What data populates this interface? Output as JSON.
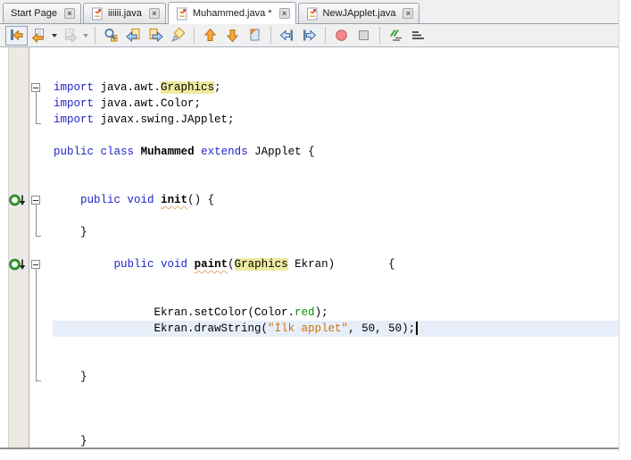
{
  "tab_bar": {
    "tabs": [
      {
        "id": "start-page",
        "label": "Start Page",
        "icon": null,
        "active": false,
        "closable": true
      },
      {
        "id": "iiiiii-java",
        "label": "iiiiii.java",
        "icon": "java-file",
        "active": false,
        "closable": true
      },
      {
        "id": "muhammed-java",
        "label": "Muhammed.java *",
        "icon": "java-file",
        "active": true,
        "closable": true,
        "modified": true
      },
      {
        "id": "newjapplet-java",
        "label": "NewJApplet.java",
        "icon": "java-file",
        "active": false,
        "closable": true
      }
    ]
  },
  "toolbar": {
    "items": [
      {
        "type": "button",
        "name": "last-edit-location",
        "framed": true
      },
      {
        "type": "button",
        "name": "back",
        "dropdown": true
      },
      {
        "type": "button",
        "name": "forward",
        "dropdown": true,
        "disabled": true
      },
      {
        "type": "separator"
      },
      {
        "type": "button",
        "name": "find-selection"
      },
      {
        "type": "button",
        "name": "find-previous-occurrence"
      },
      {
        "type": "button",
        "name": "find-next-occurrence"
      },
      {
        "type": "button",
        "name": "toggle-highlight-search"
      },
      {
        "type": "separator"
      },
      {
        "type": "button",
        "name": "previous-bookmark"
      },
      {
        "type": "button",
        "name": "next-bookmark"
      },
      {
        "type": "button",
        "name": "toggle-bookmark"
      },
      {
        "type": "separator"
      },
      {
        "type": "button",
        "name": "shift-line-left"
      },
      {
        "type": "button",
        "name": "shift-line-right"
      },
      {
        "type": "separator"
      },
      {
        "type": "button",
        "name": "start-macro-recording"
      },
      {
        "type": "button",
        "name": "stop-macro-recording"
      },
      {
        "type": "separator"
      },
      {
        "type": "button",
        "name": "comment"
      },
      {
        "type": "button",
        "name": "uncomment"
      }
    ]
  },
  "editor": {
    "language": "java",
    "current_line": 16,
    "caret": {
      "line": 16
    },
    "gutter_icons": [
      {
        "line": 8,
        "name": "overridden-method"
      },
      {
        "line": 12,
        "name": "overridden-method"
      }
    ],
    "folds": [
      {
        "start": 1,
        "end": 3
      },
      {
        "start": 8,
        "end": 10
      },
      {
        "start": 12,
        "end": 19
      }
    ],
    "lines": [
      [
        [
          "k",
          "import"
        ],
        [
          "p",
          " java.awt."
        ],
        [
          "o",
          "Graphics"
        ],
        [
          "p",
          ";"
        ]
      ],
      [
        [
          "k",
          "import"
        ],
        [
          "p",
          " java.awt.Color;"
        ]
      ],
      [
        [
          "k",
          "import"
        ],
        [
          "p",
          " javax.swing.JApplet;"
        ]
      ],
      [],
      [
        [
          "k",
          "public"
        ],
        [
          "p",
          " "
        ],
        [
          "k",
          "class"
        ],
        [
          "p",
          " "
        ],
        [
          "d",
          "Muhammed"
        ],
        [
          "p",
          " "
        ],
        [
          "k",
          "extends"
        ],
        [
          "p",
          " JApplet {"
        ]
      ],
      [],
      [],
      [
        [
          "p",
          "    "
        ],
        [
          "k",
          "public"
        ],
        [
          "p",
          " "
        ],
        [
          "k",
          "void"
        ],
        [
          "p",
          " "
        ],
        [
          "dw",
          "init"
        ],
        [
          "p",
          "() {"
        ]
      ],
      [],
      [
        [
          "p",
          "    }"
        ]
      ],
      [],
      [
        [
          "p",
          "         "
        ],
        [
          "k",
          "public"
        ],
        [
          "p",
          " "
        ],
        [
          "k",
          "void"
        ],
        [
          "p",
          " "
        ],
        [
          "dw",
          "paint"
        ],
        [
          "p",
          "("
        ],
        [
          "o",
          "Graphics"
        ],
        [
          "p",
          " Ekran)        {"
        ]
      ],
      [],
      [],
      [
        [
          "p",
          "               Ekran.setColor(Color."
        ],
        [
          "g",
          "red"
        ],
        [
          "p",
          ");"
        ]
      ],
      [
        [
          "p",
          "               Ekran.drawString("
        ],
        [
          "s",
          "\"İlk applet\""
        ],
        [
          "p",
          ", 50, 50);"
        ]
      ],
      [],
      [],
      [
        [
          "p",
          "    }"
        ]
      ],
      [],
      [],
      [],
      [
        [
          "p",
          "    }"
        ]
      ]
    ]
  },
  "colors": {
    "keyword": "#2222cc",
    "string": "#cf7400",
    "static_field": "#089000",
    "occurrence_highlight_bg": "#eeeaa0",
    "current_line_bg": "#e7eefa",
    "gutter_bg": "#eceae3",
    "toolbar_bg": "#f0f0f0",
    "tab_border": "#9aa4b2",
    "arrow_orange": "#f6a83a",
    "record_red": "#f2898c",
    "override_glyph_green": "#2ea12e"
  }
}
